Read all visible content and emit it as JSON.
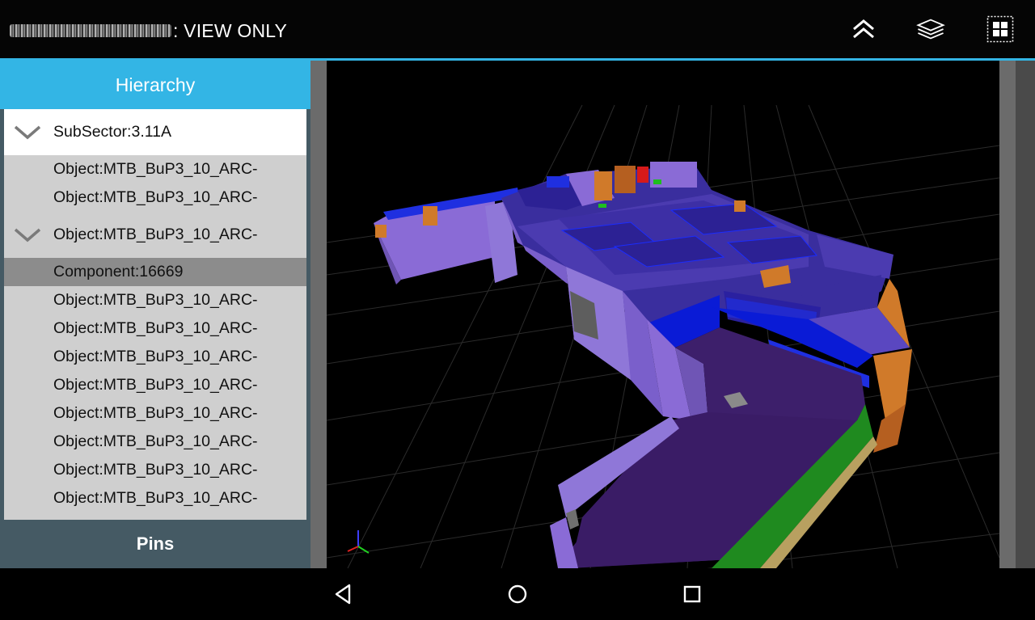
{
  "app": {
    "title_suffix": ": VIEW ONLY",
    "actions": [
      {
        "name": "chevron-up-icon"
      },
      {
        "name": "layers-icon"
      },
      {
        "name": "grid-icon"
      }
    ]
  },
  "sidebar": {
    "hierarchy_tab": "Hierarchy",
    "pins_tab": "Pins",
    "tree": [
      {
        "label": "SubSector:3.11A",
        "expanded": true,
        "style": "white"
      },
      {
        "label": "Object:MTB_BuP3_10_ARC-"
      },
      {
        "label": "Object:MTB_BuP3_10_ARC-"
      },
      {
        "label": "Object:MTB_BuP3_10_ARC-",
        "expanded": true
      },
      {
        "label": "Component:16669",
        "selected": true
      },
      {
        "label": "Object:MTB_BuP3_10_ARC-"
      },
      {
        "label": "Object:MTB_BuP3_10_ARC-"
      },
      {
        "label": "Object:MTB_BuP3_10_ARC-"
      },
      {
        "label": "Object:MTB_BuP3_10_ARC-"
      },
      {
        "label": "Object:MTB_BuP3_10_ARC-"
      },
      {
        "label": "Object:MTB_BuP3_10_ARC-"
      },
      {
        "label": "Object:MTB_BuP3_10_ARC-"
      },
      {
        "label": "Object:MTB_BuP3_10_ARC-"
      }
    ]
  },
  "navigation": {
    "buttons": [
      {
        "name": "back-icon"
      },
      {
        "name": "home-icon"
      },
      {
        "name": "recents-icon"
      }
    ]
  },
  "colors": {
    "accent": "#33b5e5",
    "sidebar_bg": "#455a64",
    "tree_bg": "#cfcfcf",
    "selected_row": "#8c8c8c",
    "model_purple": "#7b5fc4",
    "model_blue": "#0a1bd6",
    "model_orange": "#d07a2a",
    "model_green": "#1f8a1f"
  }
}
